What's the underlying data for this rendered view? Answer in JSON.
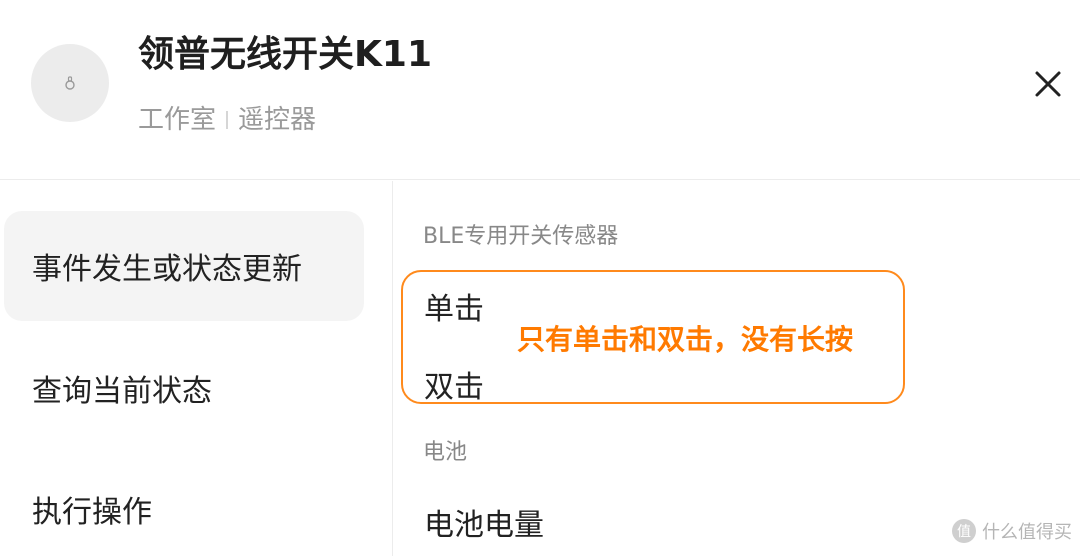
{
  "device": {
    "name": "领普无线开关K11",
    "room": "工作室",
    "type": "遥控器",
    "avatar_icon": "remote-device-icon"
  },
  "header": {
    "close_icon": "close-icon"
  },
  "menu": {
    "items": [
      {
        "label": "事件发生或状态更新",
        "active": true
      },
      {
        "label": "查询当前状态",
        "active": false
      },
      {
        "label": "执行操作",
        "active": false
      }
    ]
  },
  "sections": {
    "ble": {
      "title": "BLE专用开关传感器",
      "options": [
        "单击",
        "双击"
      ]
    },
    "battery": {
      "title": "电池",
      "options": [
        "电池电量"
      ]
    }
  },
  "annotation": {
    "text": "只有单击和双击，没有长按",
    "color": "#ff7a00"
  },
  "watermark": {
    "logo": "值",
    "text": "什么值得买"
  }
}
